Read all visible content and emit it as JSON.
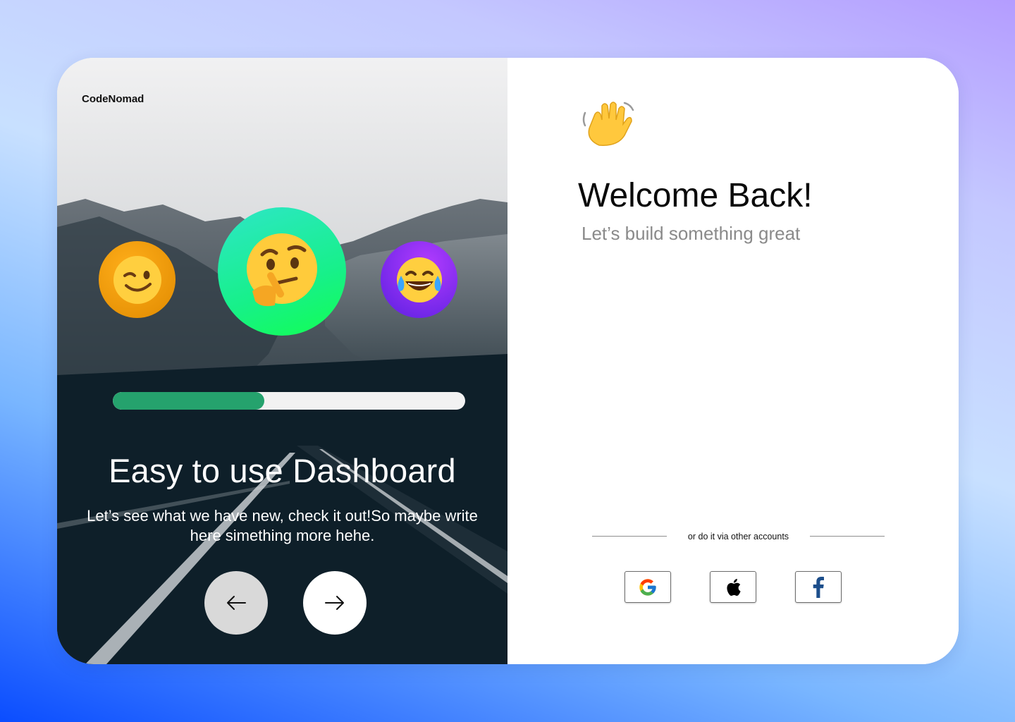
{
  "brand": {
    "name": "CodeNomad"
  },
  "hero": {
    "emojis": [
      "winking-face",
      "thinking-face",
      "face-with-tears-of-joy"
    ],
    "progress_fraction": 0.43,
    "title": "Easy to use Dashboard",
    "subtitle": "Let’s see what we have new, check it out!So maybe write here simething more hehe.",
    "nav": {
      "prev_icon": "arrow-left-icon",
      "next_icon": "arrow-right-icon"
    }
  },
  "login": {
    "emoji": "waving-hand",
    "title": "Welcome Back!",
    "tagline": "Let’s build something great",
    "divider_text": "or do it via other accounts",
    "providers": [
      "google-icon",
      "apple-icon",
      "facebook-icon"
    ]
  },
  "colors": {
    "progress_fill": "#25a26d",
    "progress_track": "#f2f2f2",
    "bubble_orange": "#f59e0b",
    "bubble_green": "#17f08a",
    "bubble_purple": "#7c2bf0",
    "prev_button": "#d9d9d9",
    "next_button": "#ffffff"
  }
}
